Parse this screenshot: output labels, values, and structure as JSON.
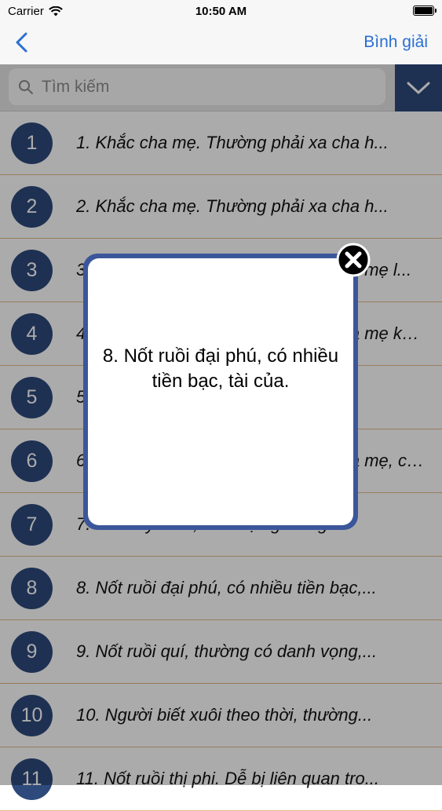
{
  "status_bar": {
    "carrier": "Carrier",
    "time": "10:50 AM"
  },
  "nav": {
    "right_label": "Bình giải"
  },
  "search": {
    "placeholder": "Tìm kiếm",
    "value": ""
  },
  "list": {
    "items": [
      {
        "number": "1",
        "text": "1. Khắc cha mẹ. Thường phải xa cha h..."
      },
      {
        "number": "2",
        "text": "2. Khắc cha mẹ. Thường phải xa cha h..."
      },
      {
        "number": "3",
        "text": "3. Khắc cha mẹ. Thường phải xa cha mẹ l..."
      },
      {
        "number": "4",
        "text": "4. Khắc cha mẹ. Thường phải xa cha mẹ khô..."
      },
      {
        "number": "5",
        "text": "5"
      },
      {
        "number": "6",
        "text": "6. Khắc cha mẹ. Thường phải xa cha mẹ, c nếu..."
      },
      {
        "number": "7",
        "text": "7. Có may mắn, làm việc gì cũng..."
      },
      {
        "number": "8",
        "text": "8. Nốt ruồi đại phú, có nhiều tiền bạc,..."
      },
      {
        "number": "9",
        "text": "9. Nốt ruồi quí, thường có danh vọng,..."
      },
      {
        "number": "10",
        "text": "10. Người biết xuôi theo thời, thường..."
      },
      {
        "number": "11",
        "text": "11. Nốt ruồi thị phi. Dễ bị liên quan tro..."
      }
    ]
  },
  "popup": {
    "text": "8. Nốt ruồi đại phú, có nhiều tiền bạc, tài của."
  },
  "colors": {
    "accent_blue": "#2a6fd3",
    "badge_navy": "#2e4a7c",
    "modal_border": "#3b569a",
    "row_divider": "#e3b98b"
  },
  "icons": {
    "back": "chevron-left-icon",
    "search": "magnifier-icon",
    "filter": "chevron-down-icon",
    "close": "close-x-icon",
    "wifi": "wifi-icon",
    "battery": "battery-icon"
  }
}
